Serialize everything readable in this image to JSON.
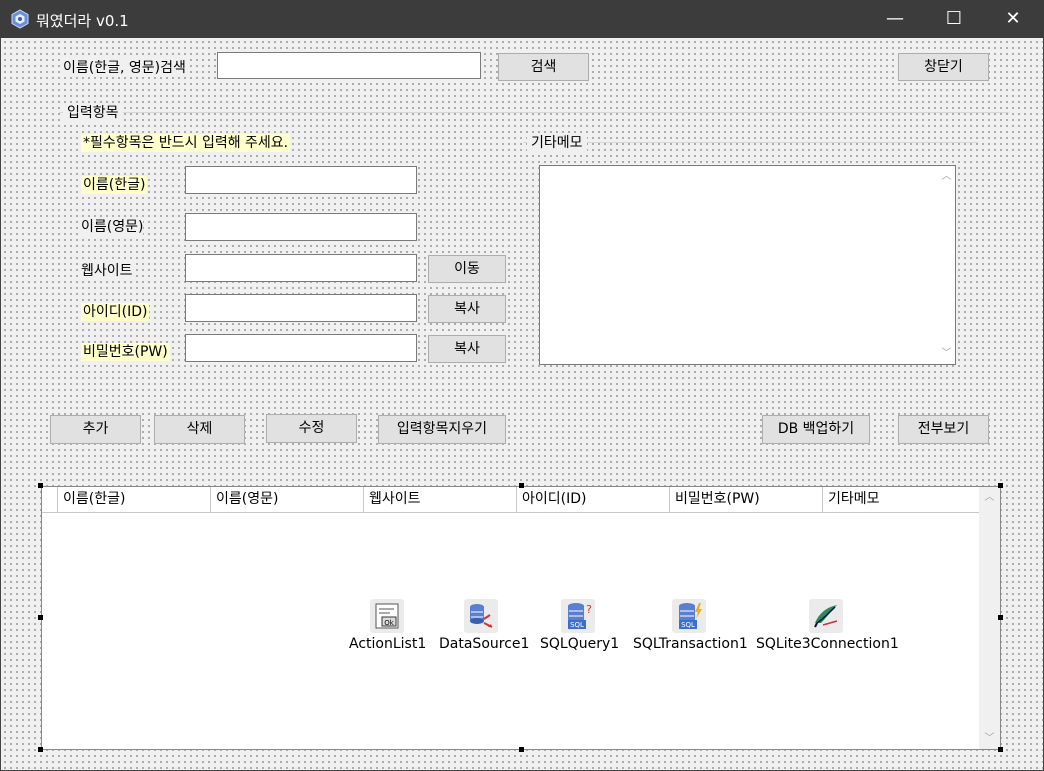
{
  "window": {
    "title": "뭐였더라 v0.1",
    "minimize": "—",
    "maximize": "☐",
    "close": "✕"
  },
  "search": {
    "label": "이름(한글, 영문)검색",
    "value": "",
    "button": "검색",
    "close_button": "창닫기"
  },
  "input_group": {
    "title": "입력항목",
    "required_note": "*필수항목은 반드시 입력해 주세요.",
    "fields": {
      "name_kr": "이름(한글)",
      "name_en": "이름(영문)",
      "website": "웹사이트",
      "id": "아이디(ID)",
      "pw": "비밀번호(PW)"
    },
    "go_button": "이동",
    "copy_id_button": "복사",
    "copy_pw_button": "복사"
  },
  "memo_group": {
    "title": "기타메모"
  },
  "actions": {
    "add": "추가",
    "delete": "삭제",
    "edit": "수정",
    "clear": "입력항목지우기",
    "backup": "DB 백업하기",
    "view_all": "전부보기"
  },
  "grid": {
    "columns": [
      "이름(한글)",
      "이름(영문)",
      "웹사이트",
      "아이디(ID)",
      "비밀번호(PW)",
      "기타메모"
    ]
  },
  "components": [
    {
      "label": "ActionList1",
      "icon": "action-list-icon"
    },
    {
      "label": "DataSource1",
      "icon": "data-source-icon"
    },
    {
      "label": "SQLQuery1",
      "icon": "sql-query-icon"
    },
    {
      "label": "SQLTransaction1",
      "icon": "sql-transaction-icon"
    },
    {
      "label": "SQLite3Connection1",
      "icon": "sqlite-connection-icon"
    }
  ],
  "colors": {
    "titlebar": "#3c3c3c",
    "form_bg": "#f0f0f0",
    "required_highlight": "#ffffcc"
  }
}
